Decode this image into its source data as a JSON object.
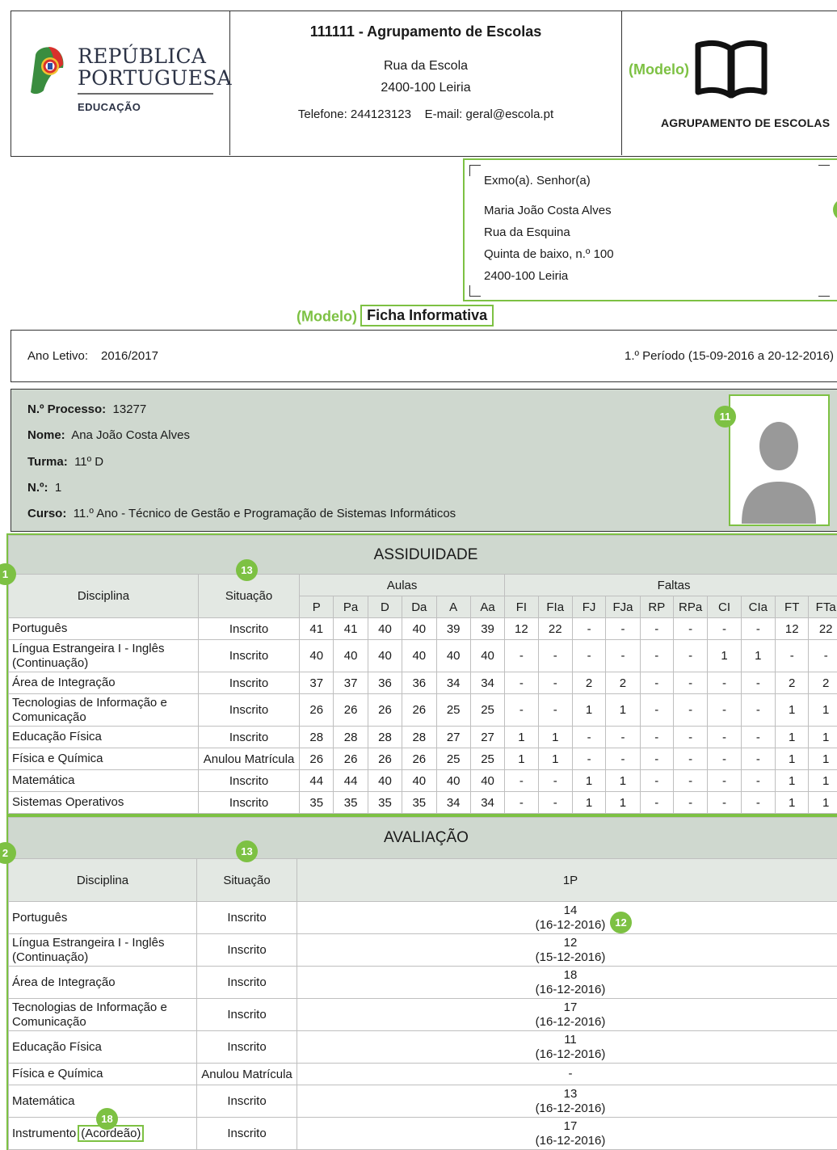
{
  "header": {
    "logo_lines": [
      "REPÚBLICA",
      "PORTUGUESA"
    ],
    "logo_sub": "EDUCAÇÃO",
    "school_title": "111111 - Agrupamento de Escolas",
    "street": "Rua da Escola",
    "postal": "2400-100 Leiria",
    "contact": "Telefone: 244123123    E-mail: geral@escola.pt",
    "modelo_label": "(Modelo)",
    "agrupamento": "AGRUPAMENTO DE ESCOLAS"
  },
  "address": {
    "salutation": "Exmo(a). Senhor(a)",
    "name": "Maria João Costa Alves",
    "street": "Rua da Esquina",
    "place": "Quinta de baixo, n.º 100",
    "postal": "2400-100 Leiria"
  },
  "title": {
    "modelo": "(Modelo)",
    "text": "Ficha Informativa"
  },
  "ano": {
    "label": "Ano Letivo:",
    "value": "2016/2017",
    "periodo": "1.º Período (15-09-2016 a 20-12-2016)"
  },
  "student": {
    "processo_label": "N.º Processo:",
    "processo": "13277",
    "nome_label": "Nome:",
    "nome": "Ana João Costa Alves",
    "turma_label": "Turma:",
    "turma": "11º D",
    "numero_label": "N.º:",
    "numero": "1",
    "curso_label": "Curso:",
    "curso": "11.º Ano - Técnico de Gestão e Programação de Sistemas Informáticos"
  },
  "badges": {
    "photo": "11",
    "assiduidade": "1",
    "situacao": "13",
    "avaliacao": "2",
    "grade": "12",
    "instrumento": "18"
  },
  "assiduidade": {
    "title": "ASSIDUIDADE",
    "col_disciplina": "Disciplina",
    "col_situacao": "Situação",
    "group_aulas": "Aulas",
    "group_faltas": "Faltas",
    "subcols": [
      "P",
      "Pa",
      "D",
      "Da",
      "A",
      "Aa",
      "FI",
      "FIa",
      "FJ",
      "FJa",
      "RP",
      "RPa",
      "CI",
      "CIa",
      "FT",
      "FTa"
    ],
    "rows": [
      {
        "disciplina": "Português",
        "situacao": "Inscrito",
        "values": [
          "41",
          "41",
          "40",
          "40",
          "39",
          "39",
          "12",
          "22",
          "-",
          "-",
          "-",
          "-",
          "-",
          "-",
          "12",
          "22"
        ]
      },
      {
        "disciplina": "Língua Estrangeira I - Inglês (Continuação)",
        "situacao": "Inscrito",
        "values": [
          "40",
          "40",
          "40",
          "40",
          "40",
          "40",
          "-",
          "-",
          "-",
          "-",
          "-",
          "-",
          "1",
          "1",
          "-",
          "-"
        ]
      },
      {
        "disciplina": "Área de Integração",
        "situacao": "Inscrito",
        "values": [
          "37",
          "37",
          "36",
          "36",
          "34",
          "34",
          "-",
          "-",
          "2",
          "2",
          "-",
          "-",
          "-",
          "-",
          "2",
          "2"
        ]
      },
      {
        "disciplina": "Tecnologias de Informação e Comunicação",
        "situacao": "Inscrito",
        "values": [
          "26",
          "26",
          "26",
          "26",
          "25",
          "25",
          "-",
          "-",
          "1",
          "1",
          "-",
          "-",
          "-",
          "-",
          "1",
          "1"
        ]
      },
      {
        "disciplina": "Educação Física",
        "situacao": "Inscrito",
        "values": [
          "28",
          "28",
          "28",
          "28",
          "27",
          "27",
          "1",
          "1",
          "-",
          "-",
          "-",
          "-",
          "-",
          "-",
          "1",
          "1"
        ]
      },
      {
        "disciplina": "Física e Química",
        "situacao": "Anulou Matrícula",
        "values": [
          "26",
          "26",
          "26",
          "26",
          "25",
          "25",
          "1",
          "1",
          "-",
          "-",
          "-",
          "-",
          "-",
          "-",
          "1",
          "1"
        ]
      },
      {
        "disciplina": "Matemática",
        "situacao": "Inscrito",
        "values": [
          "44",
          "44",
          "40",
          "40",
          "40",
          "40",
          "-",
          "-",
          "1",
          "1",
          "-",
          "-",
          "-",
          "-",
          "1",
          "1"
        ]
      },
      {
        "disciplina": "Sistemas Operativos",
        "situacao": "Inscrito",
        "values": [
          "35",
          "35",
          "35",
          "35",
          "34",
          "34",
          "-",
          "-",
          "1",
          "1",
          "-",
          "-",
          "-",
          "-",
          "1",
          "1"
        ]
      }
    ]
  },
  "avaliacao": {
    "title": "AVALIAÇÃO",
    "col_disciplina": "Disciplina",
    "col_situacao": "Situação",
    "col_periodo": "1P",
    "rows": [
      {
        "disciplina": "Português",
        "situacao": "Inscrito",
        "nota": "14",
        "data": "(16-12-2016)"
      },
      {
        "disciplina": "Língua Estrangeira I - Inglês (Continuação)",
        "situacao": "Inscrito",
        "nota": "12",
        "data": "(15-12-2016)"
      },
      {
        "disciplina": "Área de Integração",
        "situacao": "Inscrito",
        "nota": "18",
        "data": "(16-12-2016)"
      },
      {
        "disciplina": "Tecnologias de Informação e Comunicação",
        "situacao": "Inscrito",
        "nota": "17",
        "data": "(16-12-2016)"
      },
      {
        "disciplina": "Educação Física",
        "situacao": "Inscrito",
        "nota": "11",
        "data": "(16-12-2016)"
      },
      {
        "disciplina": "Física e Química",
        "situacao": "Anulou Matrícula",
        "nota": "-",
        "data": ""
      },
      {
        "disciplina": "Matemática",
        "situacao": "Inscrito",
        "nota": "13",
        "data": "(16-12-2016)"
      },
      {
        "disciplina": "Instrumento",
        "disciplina_extra": "(Acordeão)",
        "situacao": "Inscrito",
        "nota": "17",
        "data": "(16-12-2016)"
      }
    ]
  }
}
